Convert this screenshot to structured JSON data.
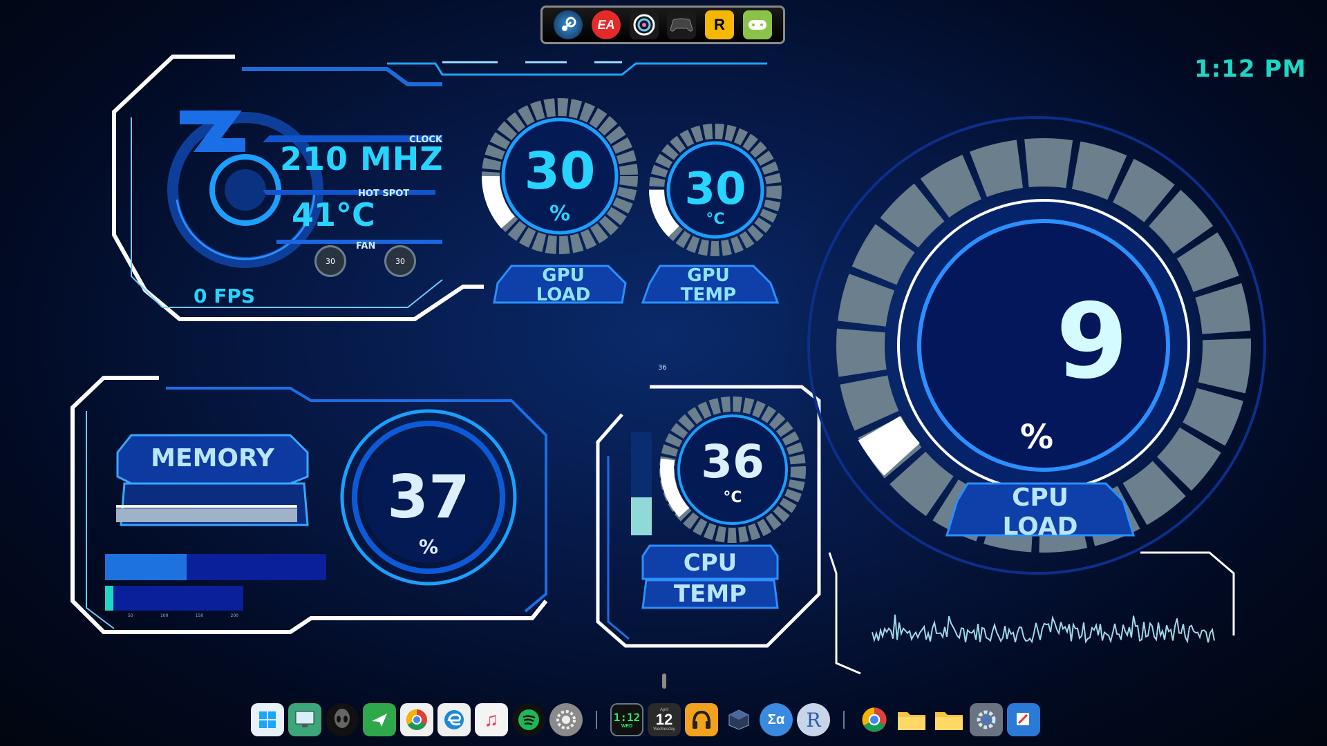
{
  "clock": {
    "time": "1:12 PM"
  },
  "gpu": {
    "clock_label": "CLOCK",
    "clock_value": "210 MHZ",
    "hotspot_label": "HOT SPOT",
    "hotspot_value": "41°C",
    "fan_label": "FAN",
    "fan1": "30",
    "fan2": "30",
    "fps": "0 FPS",
    "load_value": "30",
    "load_unit": "%",
    "load_label_1": "GPU",
    "load_label_2": "LOAD",
    "temp_value": "30",
    "temp_unit": "°C",
    "temp_label_1": "GPU",
    "temp_label_2": "TEMP"
  },
  "memory": {
    "label": "MEMORY",
    "value": "37",
    "unit": "%",
    "bar_fraction": 0.37,
    "ticks": [
      "50",
      "100",
      "150",
      "200"
    ]
  },
  "cpu_temp": {
    "small_value": "36",
    "value": "36",
    "unit": "°C",
    "label_1": "CPU",
    "label_2": "TEMP"
  },
  "cpu_load": {
    "value": "9",
    "unit": "%",
    "label_1": "CPU",
    "label_2": "LOAD"
  },
  "top_launcher": {
    "icons": [
      "steam-icon",
      "ea-icon",
      "ubisoft-icon",
      "gamepad-icon",
      "rockstar-icon",
      "xbox-games-icon"
    ],
    "ea_text": "EA",
    "rockstar_text": "R"
  },
  "dock": {
    "calendar_month": "April",
    "calendar_day": "12",
    "calendar_weekday": "Wednesday",
    "digital_clock": "1:12",
    "digital_day": "WED",
    "r_text": "R",
    "sigma_text": "Σα"
  },
  "colors": {
    "accent": "#22b8ff",
    "cyan": "#7fe8ff",
    "teal": "#1fc9b9",
    "white": "#ffffff"
  }
}
